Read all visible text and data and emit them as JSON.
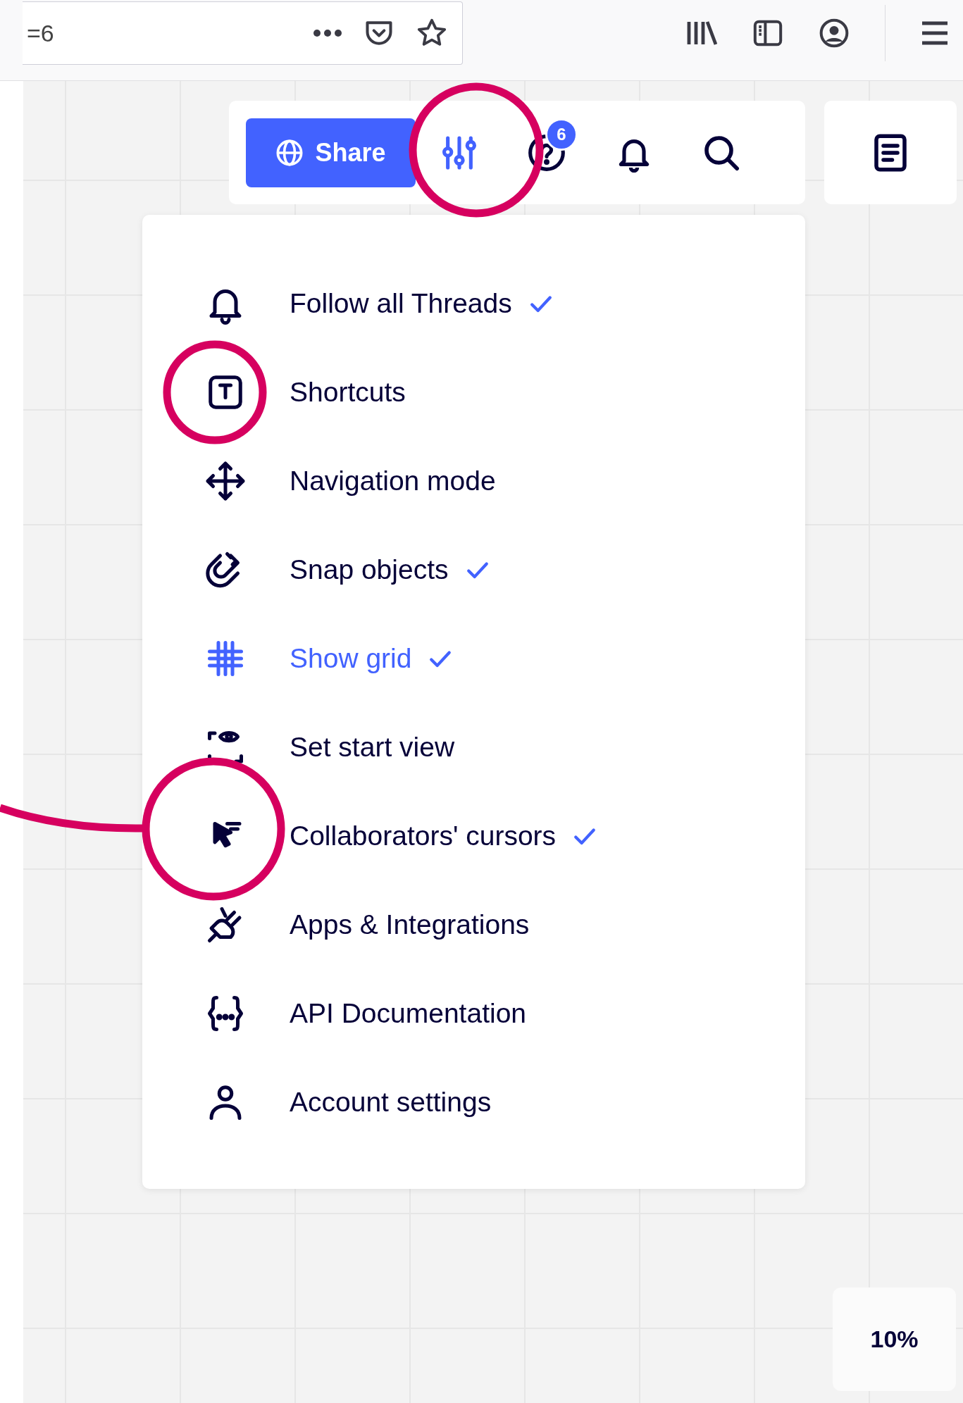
{
  "browser_toolbar": {
    "address_text": "=6"
  },
  "board_toolbar": {
    "share_button": "Share",
    "help_badge": "6"
  },
  "settings_menu": {
    "items": [
      {
        "kind": "bell",
        "label": "Follow all Threads",
        "checked": true,
        "selected": false
      },
      {
        "kind": "keyboard",
        "label": "Shortcuts",
        "checked": false,
        "selected": false
      },
      {
        "kind": "move",
        "label": "Navigation mode",
        "checked": false,
        "selected": false
      },
      {
        "kind": "magnet",
        "label": "Snap objects",
        "checked": true,
        "selected": false
      },
      {
        "kind": "grid",
        "label": "Show grid",
        "checked": true,
        "selected": true
      },
      {
        "kind": "eye",
        "label": "Set start view",
        "checked": false,
        "selected": false
      },
      {
        "kind": "cursor",
        "label": "Collaborators' cursors",
        "checked": true,
        "selected": false
      },
      {
        "kind": "plug",
        "label": "Apps & Integrations",
        "checked": false,
        "selected": false
      },
      {
        "kind": "braces",
        "label": "API Documentation",
        "checked": false,
        "selected": false
      },
      {
        "kind": "person",
        "label": "Account settings",
        "checked": false,
        "selected": false
      }
    ]
  },
  "zoom_level": "10%"
}
